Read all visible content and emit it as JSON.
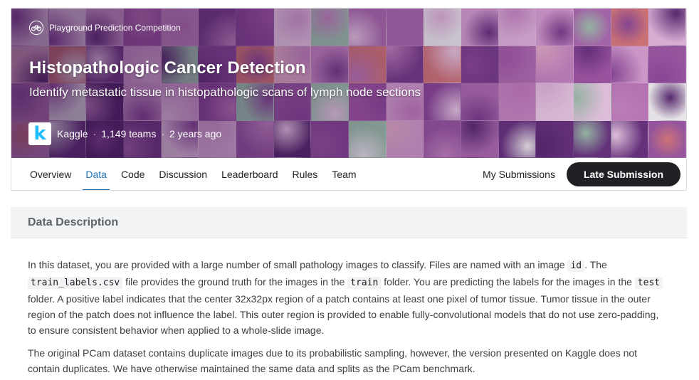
{
  "header": {
    "competition_type": "Playground Prediction Competition",
    "competition_type_icon": "bicycle-icon",
    "title": "Histopathologic Cancer Detection",
    "subtitle": "Identify metastatic tissue in histopathologic scans of lymph node sections",
    "host_logo_letter": "k",
    "host": "Kaggle",
    "separator": "·",
    "teams": "1,149 teams",
    "posted": "2 years ago"
  },
  "tabs": [
    "Overview",
    "Data",
    "Code",
    "Discussion",
    "Leaderboard",
    "Rules",
    "Team"
  ],
  "active_tab": "Data",
  "actions": {
    "my_submissions": "My Submissions",
    "late_submission": "Late Submission"
  },
  "section": {
    "title": "Data Description"
  },
  "description": {
    "p1": {
      "t1": "In this dataset, you are provided with a large number of small pathology images to classify. Files are named with an image ",
      "c1": "id",
      "t2": ". The ",
      "c2": "train_labels.csv",
      "t3": " file provides the ground truth for the images in the ",
      "c3": "train",
      "t4": " folder. You are predicting the labels for the images in the ",
      "c4": "test",
      "t5": " folder. A positive label indicates that the center 32x32px region of a patch contains at least one pixel of tumor tissue. Tumor tissue in the outer region of the patch does not influence the label. This outer region is provided to enable fully-convolutional models that do not use zero-padding, to ensure consistent behavior when applied to a whole-slide image."
    },
    "p2": "The original PCam dataset contains duplicate images due to its probabilistic sampling, however, the version presented on Kaggle does not contain duplicates. We have otherwise maintained the same data and splits as the PCam benchmark."
  },
  "colors": {
    "accent": "#1a73b8",
    "button_dark": "#202124",
    "kaggle_blue": "#20beff",
    "banner_palette": [
      "#7b3f8c",
      "#a65aa8",
      "#c98ac5",
      "#e4b9de",
      "#5a2a70",
      "#b06fb2",
      "#d9a3d3",
      "#8e4a9b",
      "#f0d2ea",
      "#6a3480",
      "#c27cbd",
      "#9c5aa4",
      "#e8b2c9",
      "#d77a7a",
      "#f2f2f2",
      "#a3c9b0"
    ]
  }
}
